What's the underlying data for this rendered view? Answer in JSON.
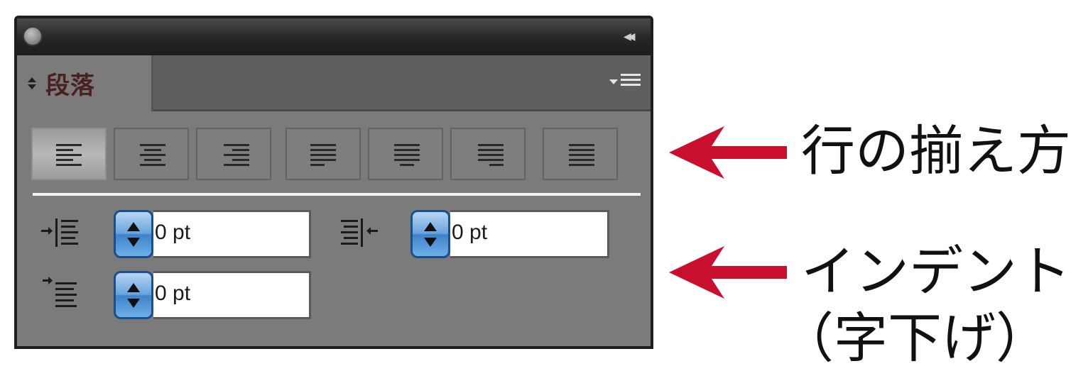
{
  "panel": {
    "tab_label": "段落",
    "icons": {
      "close": "close-dot-icon",
      "collapse": "double-chevron-collapse-icon",
      "flyout": "panel-menu-icon",
      "tab_arrows": "up-down-arrows-icon"
    }
  },
  "alignment": {
    "buttons": [
      {
        "id": "align-left",
        "icon": "align-left-icon",
        "active": true
      },
      {
        "id": "align-center",
        "icon": "align-center-icon",
        "active": false
      },
      {
        "id": "align-right",
        "icon": "align-right-icon",
        "active": false
      },
      {
        "id": "justify-last-left",
        "icon": "justify-last-left-icon",
        "active": false
      },
      {
        "id": "justify-last-center",
        "icon": "justify-last-center-icon",
        "active": false
      },
      {
        "id": "justify-last-right",
        "icon": "justify-last-right-icon",
        "active": false
      },
      {
        "id": "justify-all",
        "icon": "justify-all-icon",
        "active": false
      }
    ]
  },
  "indents": {
    "left": {
      "value": "0 pt",
      "icon": "left-indent-icon"
    },
    "right": {
      "value": "0 pt",
      "icon": "right-indent-icon"
    },
    "first_line": {
      "value": "0 pt",
      "icon": "first-line-indent-icon"
    }
  },
  "annotations": {
    "alignment": "行の揃え方",
    "indent_line1": "インデント",
    "indent_line2": "（字下げ）"
  },
  "colors": {
    "panel_bg": "#7b7b7b",
    "titlebar": "#262626",
    "spinner_blue": "#3e82c9",
    "arrow_red": "#c8102e"
  }
}
